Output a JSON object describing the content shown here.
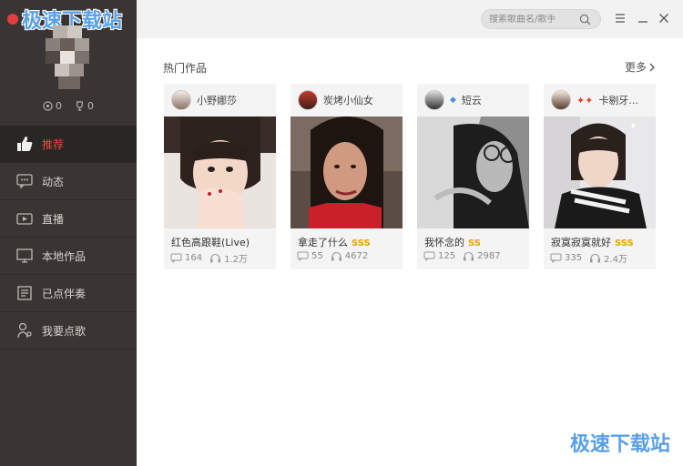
{
  "app": {
    "watermark_top": "极速下载站",
    "watermark_bottom": "极速下载站"
  },
  "profile": {
    "stat_flowers": "0",
    "stat_trophies": "0"
  },
  "sidebar": {
    "items": [
      {
        "label": "推荐",
        "icon": "thumbs-up-icon"
      },
      {
        "label": "动态",
        "icon": "chat-icon"
      },
      {
        "label": "直播",
        "icon": "video-icon"
      },
      {
        "label": "本地作品",
        "icon": "monitor-icon"
      },
      {
        "label": "已点伴奏",
        "icon": "list-icon"
      },
      {
        "label": "我要点歌",
        "icon": "singer-icon"
      }
    ],
    "active_color": "#e94b3c"
  },
  "search": {
    "placeholder": "搜索歌曲名/歌手"
  },
  "main": {
    "section_title": "热门作品",
    "more_label": "更多",
    "cards": [
      {
        "user": "小野娜莎",
        "title": "红色高跟鞋(Live)",
        "badge": "",
        "comments": "164",
        "plays": "1.2万"
      },
      {
        "user": "炭烤小仙女",
        "title": "拿走了什么",
        "badge": "SSS",
        "comments": "55",
        "plays": "4672"
      },
      {
        "user": "短云",
        "title": "我怀念的",
        "badge": "SS",
        "comments": "125",
        "plays": "2987"
      },
      {
        "user": "卡剔牙...",
        "title": "寂寞寂寞就好",
        "badge": "SSS",
        "comments": "335",
        "plays": "2.4万"
      }
    ]
  }
}
